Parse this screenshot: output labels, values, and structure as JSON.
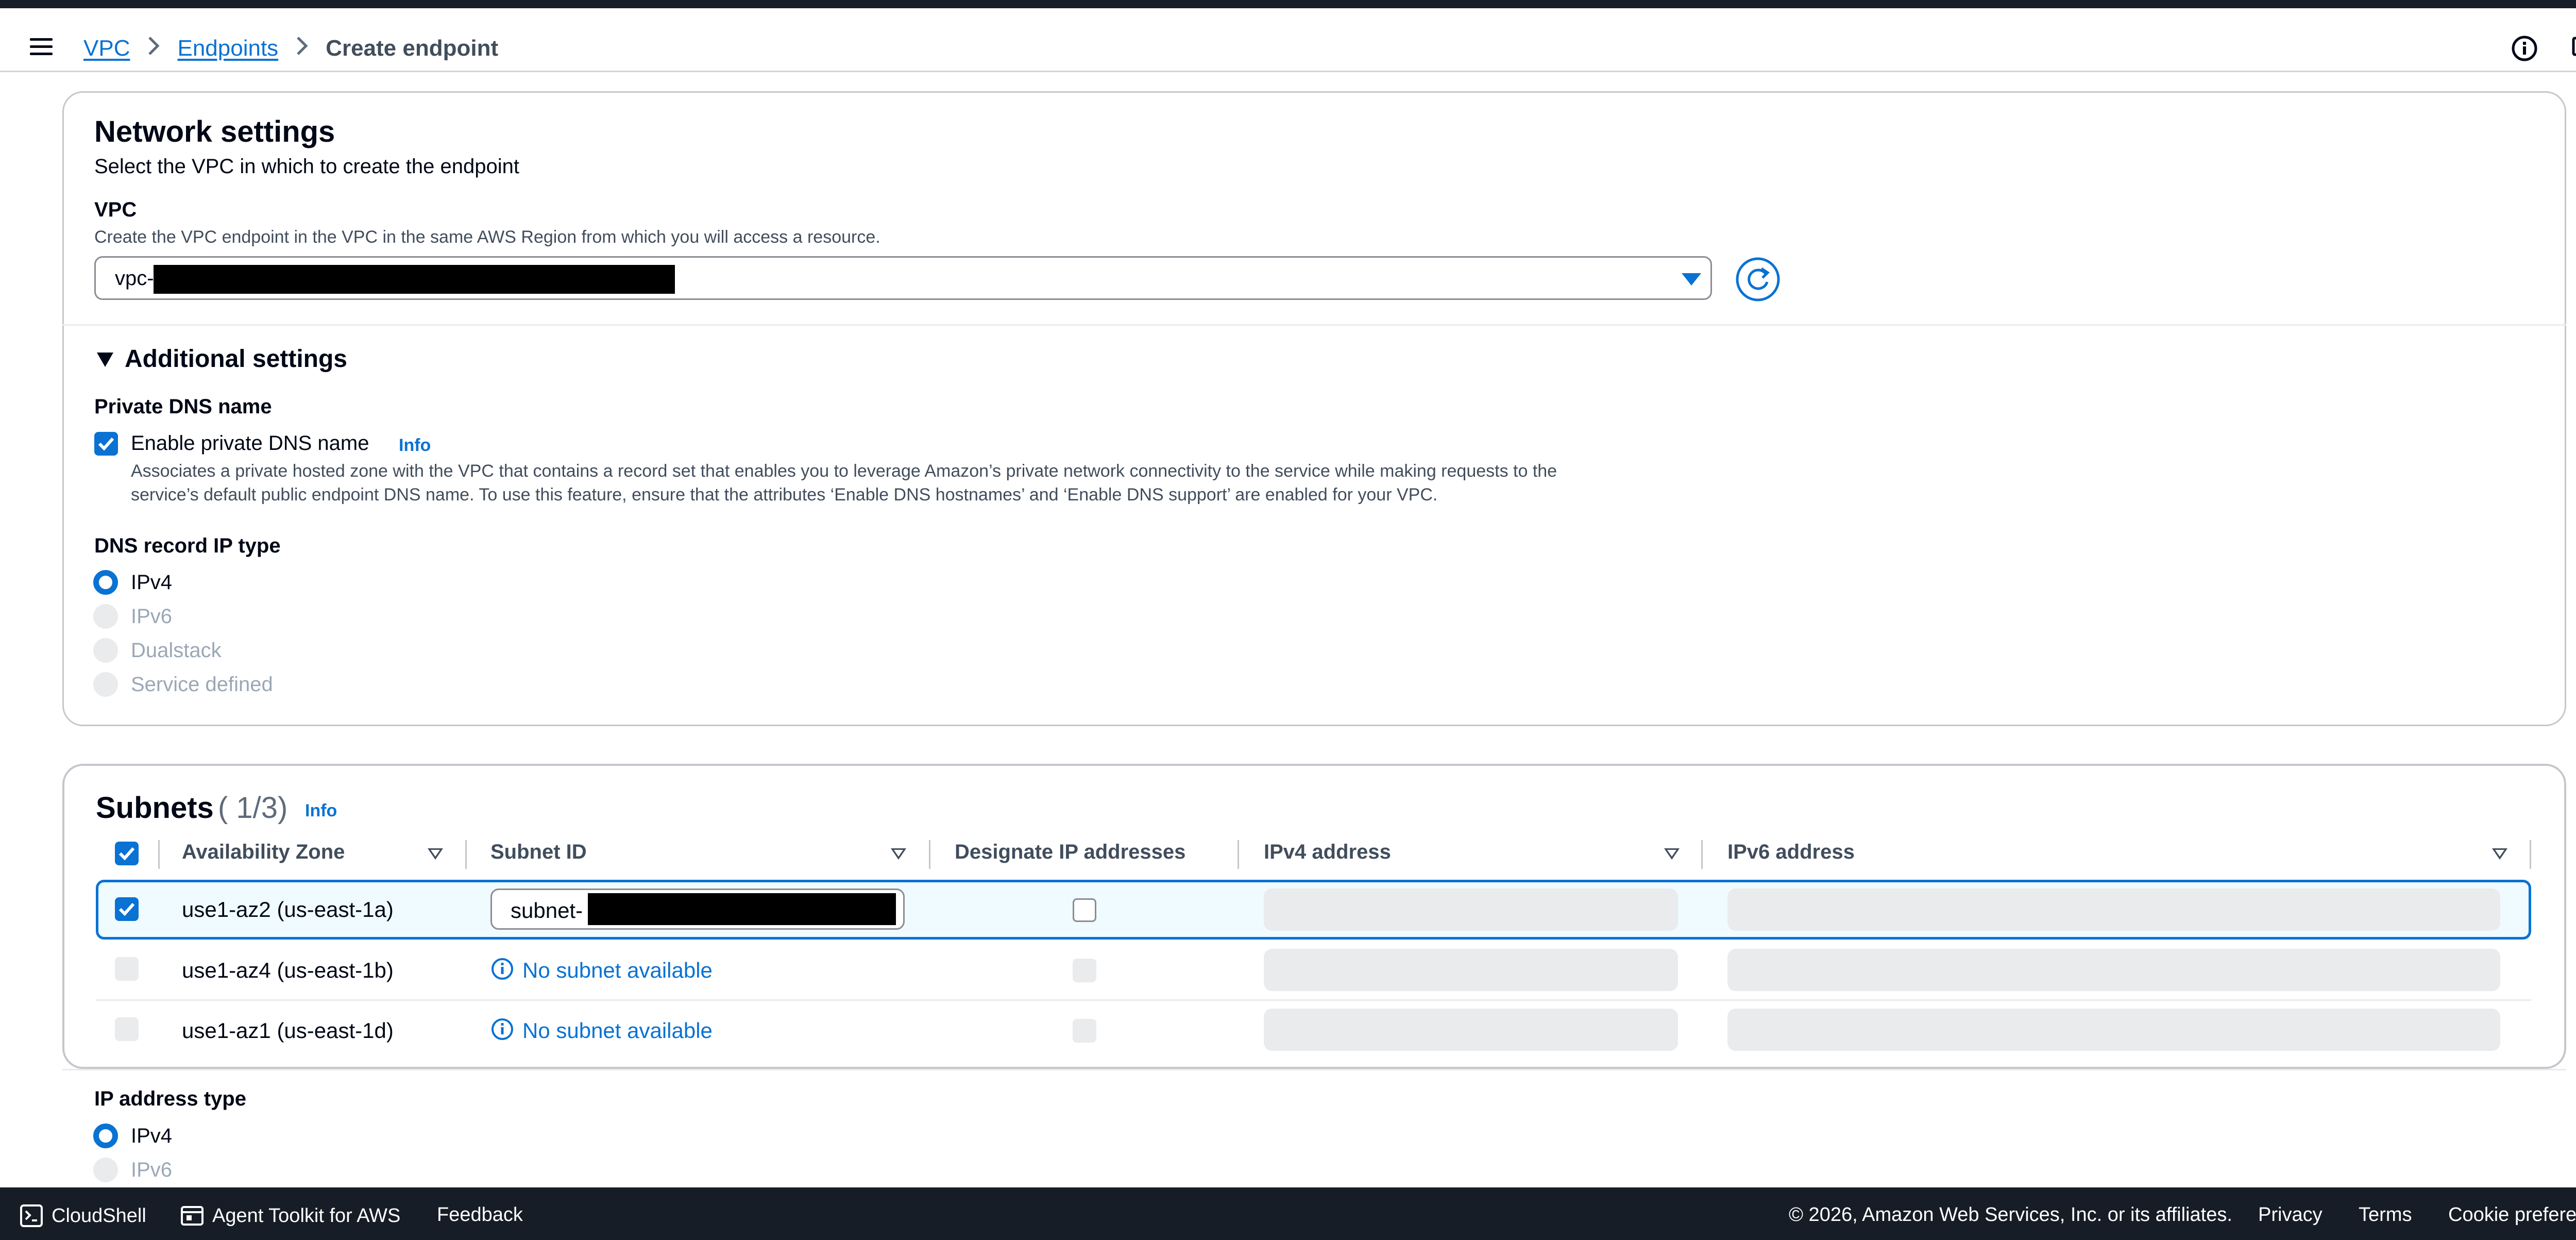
{
  "breadcrumb": {
    "vpc": "VPC",
    "endpoints": "Endpoints",
    "current": "Create endpoint"
  },
  "network": {
    "title": "Network settings",
    "description": "Select the VPC in which to create the endpoint",
    "vpc_label": "VPC",
    "vpc_hint": "Create the VPC endpoint in the VPC in the same AWS Region from which you will access a resource.",
    "vpc_value": "vpc-"
  },
  "additional": {
    "title": "Additional settings",
    "private_dns_label": "Private DNS name",
    "enable_dns_label": "Enable private DNS name",
    "info": "Info",
    "dns_hint_1": "Associates a private hosted zone with the VPC that contains a record set that enables you to leverage Amazon’s private network connectivity to the service while making requests to the",
    "dns_hint_2": "service’s default public endpoint DNS name. To use this feature, ensure that the attributes ‘Enable DNS hostnames’ and ‘Enable DNS support’ are enabled for your VPC.",
    "dns_record_label": "DNS record IP type",
    "options": [
      "IPv4",
      "IPv6",
      "Dualstack",
      "Service defined"
    ]
  },
  "subnets": {
    "title": "Subnets",
    "count": "( 1/3)",
    "info": "Info",
    "columns": [
      "Availability Zone",
      "Subnet ID",
      "Designate IP addresses",
      "IPv4 address",
      "IPv6 address"
    ],
    "rows": [
      {
        "az": "use1-az2 (us-east-1a)",
        "subnet": "subnet-"
      },
      {
        "az": "use1-az4 (us-east-1b)",
        "subnet": "No subnet available"
      },
      {
        "az": "use1-az1 (us-east-1d)",
        "subnet": "No subnet available"
      }
    ]
  },
  "ip_address_type": {
    "label": "IP address type",
    "options": [
      "IPv4",
      "IPv6"
    ]
  },
  "footer": {
    "cloudshell": "CloudShell",
    "agent_toolkit": "Agent Toolkit for AWS",
    "feedback": "Feedback",
    "copyright": "© 2026, Amazon Web Services, Inc. or its affiliates.",
    "privacy": "Privacy",
    "terms": "Terms",
    "cookies": "Cookie preferences"
  },
  "colors": {
    "accent": "#0972d3",
    "text": "#000716",
    "footer_bg": "#161d26",
    "disabled": "#e9ebed"
  }
}
